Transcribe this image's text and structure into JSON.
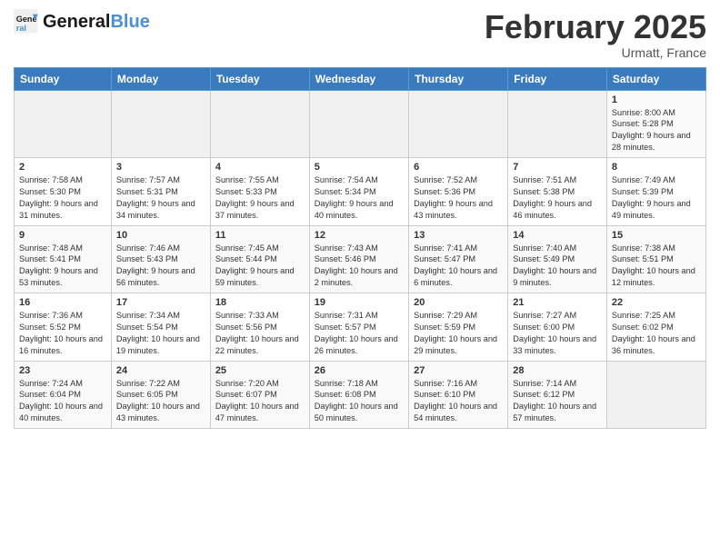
{
  "header": {
    "logo_line1": "General",
    "logo_line2": "Blue",
    "month": "February 2025",
    "location": "Urmatt, France"
  },
  "weekdays": [
    "Sunday",
    "Monday",
    "Tuesday",
    "Wednesday",
    "Thursday",
    "Friday",
    "Saturday"
  ],
  "weeks": [
    [
      {
        "day": "",
        "detail": ""
      },
      {
        "day": "",
        "detail": ""
      },
      {
        "day": "",
        "detail": ""
      },
      {
        "day": "",
        "detail": ""
      },
      {
        "day": "",
        "detail": ""
      },
      {
        "day": "",
        "detail": ""
      },
      {
        "day": "1",
        "detail": "Sunrise: 8:00 AM\nSunset: 5:28 PM\nDaylight: 9 hours and 28 minutes."
      }
    ],
    [
      {
        "day": "2",
        "detail": "Sunrise: 7:58 AM\nSunset: 5:30 PM\nDaylight: 9 hours and 31 minutes."
      },
      {
        "day": "3",
        "detail": "Sunrise: 7:57 AM\nSunset: 5:31 PM\nDaylight: 9 hours and 34 minutes."
      },
      {
        "day": "4",
        "detail": "Sunrise: 7:55 AM\nSunset: 5:33 PM\nDaylight: 9 hours and 37 minutes."
      },
      {
        "day": "5",
        "detail": "Sunrise: 7:54 AM\nSunset: 5:34 PM\nDaylight: 9 hours and 40 minutes."
      },
      {
        "day": "6",
        "detail": "Sunrise: 7:52 AM\nSunset: 5:36 PM\nDaylight: 9 hours and 43 minutes."
      },
      {
        "day": "7",
        "detail": "Sunrise: 7:51 AM\nSunset: 5:38 PM\nDaylight: 9 hours and 46 minutes."
      },
      {
        "day": "8",
        "detail": "Sunrise: 7:49 AM\nSunset: 5:39 PM\nDaylight: 9 hours and 49 minutes."
      }
    ],
    [
      {
        "day": "9",
        "detail": "Sunrise: 7:48 AM\nSunset: 5:41 PM\nDaylight: 9 hours and 53 minutes."
      },
      {
        "day": "10",
        "detail": "Sunrise: 7:46 AM\nSunset: 5:43 PM\nDaylight: 9 hours and 56 minutes."
      },
      {
        "day": "11",
        "detail": "Sunrise: 7:45 AM\nSunset: 5:44 PM\nDaylight: 9 hours and 59 minutes."
      },
      {
        "day": "12",
        "detail": "Sunrise: 7:43 AM\nSunset: 5:46 PM\nDaylight: 10 hours and 2 minutes."
      },
      {
        "day": "13",
        "detail": "Sunrise: 7:41 AM\nSunset: 5:47 PM\nDaylight: 10 hours and 6 minutes."
      },
      {
        "day": "14",
        "detail": "Sunrise: 7:40 AM\nSunset: 5:49 PM\nDaylight: 10 hours and 9 minutes."
      },
      {
        "day": "15",
        "detail": "Sunrise: 7:38 AM\nSunset: 5:51 PM\nDaylight: 10 hours and 12 minutes."
      }
    ],
    [
      {
        "day": "16",
        "detail": "Sunrise: 7:36 AM\nSunset: 5:52 PM\nDaylight: 10 hours and 16 minutes."
      },
      {
        "day": "17",
        "detail": "Sunrise: 7:34 AM\nSunset: 5:54 PM\nDaylight: 10 hours and 19 minutes."
      },
      {
        "day": "18",
        "detail": "Sunrise: 7:33 AM\nSunset: 5:56 PM\nDaylight: 10 hours and 22 minutes."
      },
      {
        "day": "19",
        "detail": "Sunrise: 7:31 AM\nSunset: 5:57 PM\nDaylight: 10 hours and 26 minutes."
      },
      {
        "day": "20",
        "detail": "Sunrise: 7:29 AM\nSunset: 5:59 PM\nDaylight: 10 hours and 29 minutes."
      },
      {
        "day": "21",
        "detail": "Sunrise: 7:27 AM\nSunset: 6:00 PM\nDaylight: 10 hours and 33 minutes."
      },
      {
        "day": "22",
        "detail": "Sunrise: 7:25 AM\nSunset: 6:02 PM\nDaylight: 10 hours and 36 minutes."
      }
    ],
    [
      {
        "day": "23",
        "detail": "Sunrise: 7:24 AM\nSunset: 6:04 PM\nDaylight: 10 hours and 40 minutes."
      },
      {
        "day": "24",
        "detail": "Sunrise: 7:22 AM\nSunset: 6:05 PM\nDaylight: 10 hours and 43 minutes."
      },
      {
        "day": "25",
        "detail": "Sunrise: 7:20 AM\nSunset: 6:07 PM\nDaylight: 10 hours and 47 minutes."
      },
      {
        "day": "26",
        "detail": "Sunrise: 7:18 AM\nSunset: 6:08 PM\nDaylight: 10 hours and 50 minutes."
      },
      {
        "day": "27",
        "detail": "Sunrise: 7:16 AM\nSunset: 6:10 PM\nDaylight: 10 hours and 54 minutes."
      },
      {
        "day": "28",
        "detail": "Sunrise: 7:14 AM\nSunset: 6:12 PM\nDaylight: 10 hours and 57 minutes."
      },
      {
        "day": "",
        "detail": ""
      }
    ]
  ]
}
